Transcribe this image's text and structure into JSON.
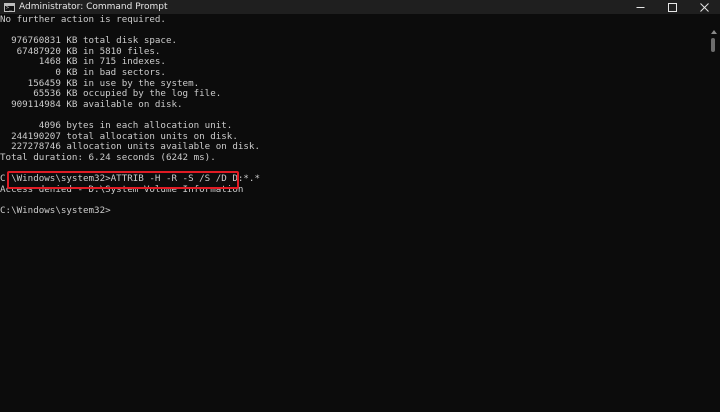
{
  "window": {
    "title": "Administrator: Command Prompt",
    "icon": "command-prompt-icon",
    "controls": [
      "minimize-icon",
      "maximize-icon",
      "close-icon"
    ]
  },
  "console": {
    "lines": [
      "No further action is required.",
      "",
      "  976760831 KB total disk space.",
      "   67487920 KB in 5810 files.",
      "       1468 KB in 715 indexes.",
      "          0 KB in bad sectors.",
      "     156459 KB in use by the system.",
      "      65536 KB occupied by the log file.",
      "  909114984 KB available on disk.",
      "",
      "       4096 bytes in each allocation unit.",
      "  244190207 total allocation units on disk.",
      "  227278746 allocation units available on disk.",
      "Total duration: 6.24 seconds (6242 ms).",
      "",
      "C:\\Windows\\system32>ATTRIB -H -R -S /S /D D:*.*",
      "Access denied - D:\\System Volume Information",
      "",
      "C:\\Windows\\system32>"
    ],
    "highlighted_command": "C:\\Windows\\system32>ATTRIB -H -R -S /S /D D:*.*",
    "text_color": "#cccccc",
    "background_color": "#0c0c0c",
    "highlight_color": "#e01b24"
  }
}
